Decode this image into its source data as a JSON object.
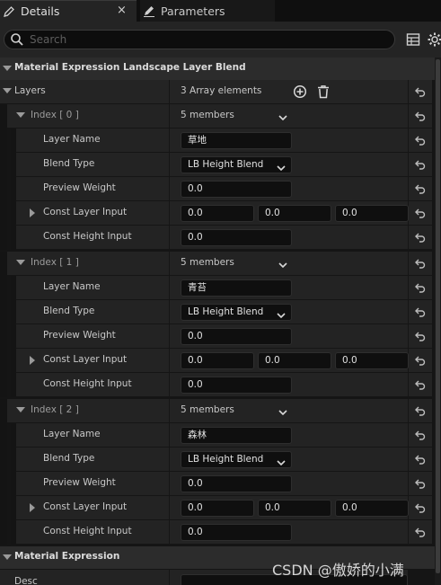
{
  "tabs": [
    {
      "label": "Details",
      "close": "×"
    },
    {
      "label": "Parameters"
    }
  ],
  "search": {
    "placeholder": "Search",
    "value": ""
  },
  "categories": {
    "layer_blend": "Material Expression Landscape Layer Blend",
    "material_expression": "Material Expression"
  },
  "layers": {
    "label": "Layers",
    "summary": "3 Array elements",
    "items": [
      {
        "index": "Index [ 0 ]",
        "members": "5 members",
        "layer_name_label": "Layer Name",
        "layer_name": "草地",
        "blend_type_label": "Blend Type",
        "blend_type": "LB Height Blend",
        "preview_weight_label": "Preview Weight",
        "preview_weight": "0.0",
        "const_layer_input_label": "Const Layer Input",
        "const_layer_input": [
          "0.0",
          "0.0",
          "0.0"
        ],
        "const_height_input_label": "Const Height Input",
        "const_height_input": "0.0"
      },
      {
        "index": "Index [ 1 ]",
        "members": "5 members",
        "layer_name_label": "Layer Name",
        "layer_name": "青苔",
        "blend_type_label": "Blend Type",
        "blend_type": "LB Height Blend",
        "preview_weight_label": "Preview Weight",
        "preview_weight": "0.0",
        "const_layer_input_label": "Const Layer Input",
        "const_layer_input": [
          "0.0",
          "0.0",
          "0.0"
        ],
        "const_height_input_label": "Const Height Input",
        "const_height_input": "0.0"
      },
      {
        "index": "Index [ 2 ]",
        "members": "5 members",
        "layer_name_label": "Layer Name",
        "layer_name": "森林",
        "blend_type_label": "Blend Type",
        "blend_type": "LB Height Blend",
        "preview_weight_label": "Preview Weight",
        "preview_weight": "0.0",
        "const_layer_input_label": "Const Layer Input",
        "const_layer_input": [
          "0.0",
          "0.0",
          "0.0"
        ],
        "const_height_input_label": "Const Height Input",
        "const_height_input": "0.0"
      }
    ]
  },
  "desc": {
    "label": "Desc",
    "value": ""
  },
  "watermark": "CSDN @傲娇的小满",
  "colors": {
    "background": "#151515",
    "row": "#232323",
    "category": "#2c2c2c",
    "field": "#0f0f0f"
  }
}
